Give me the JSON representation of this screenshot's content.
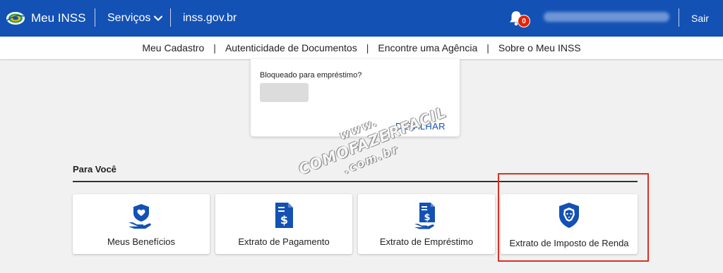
{
  "header": {
    "app_title": "Meu INSS",
    "services_label": "Serviços",
    "site_link": "inss.gov.br",
    "notification_count": "0",
    "logout_label": "Sair"
  },
  "subnav": {
    "items": [
      "Meu Cadastro",
      "Autenticidade de Documentos",
      "Encontre uma Agência",
      "Sobre o Meu INSS"
    ],
    "separator": "|"
  },
  "loan_card": {
    "question": "Bloqueado para empréstimo?",
    "detail_label": "DETALHAR"
  },
  "watermark": {
    "line1": "www.",
    "line2": "COMOFAZERFACIL",
    "line3": ".com.br"
  },
  "section": {
    "title": "Para Você"
  },
  "cards": [
    {
      "label": "Meus Benefícios",
      "icon": "heart-hand-icon"
    },
    {
      "label": "Extrato de Pagamento",
      "icon": "dollar-document-icon"
    },
    {
      "label": "Extrato de Empréstimo",
      "icon": "dollar-document-hand-icon"
    },
    {
      "label": "Extrato de Imposto de Renda",
      "icon": "lion-shield-icon"
    }
  ],
  "colors": {
    "header_blue": "#1351b4",
    "icon_blue": "#1351b4",
    "badge_red": "#e52207",
    "highlight_red": "#d93025"
  }
}
